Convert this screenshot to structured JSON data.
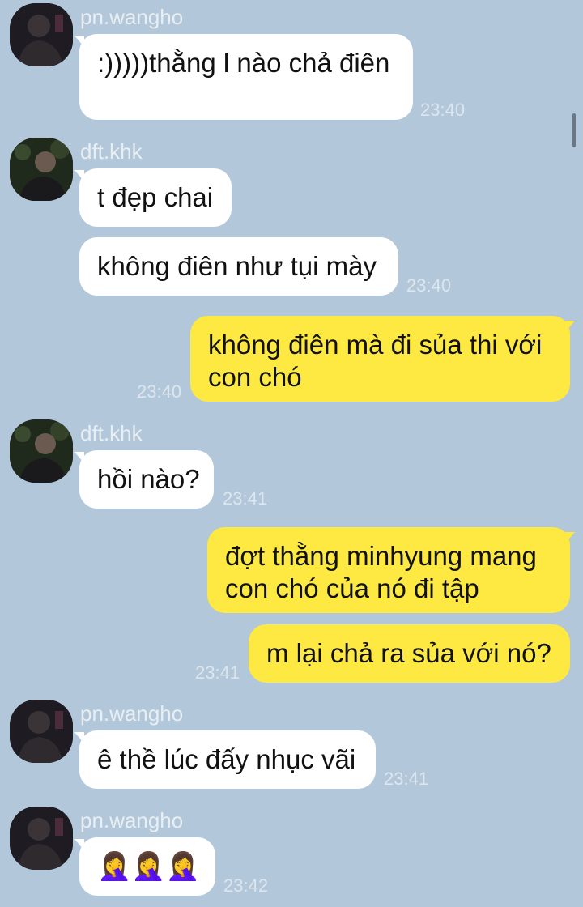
{
  "colors": {
    "background": "#b2c7d9",
    "incoming": "#ffffff",
    "outgoing": "#fde941",
    "timestamp": "#dde6ee"
  },
  "messages": [
    {
      "sender": "pn.wangho",
      "text": ":)))))thằng l nào chả điên",
      "time": "23:40"
    },
    {
      "sender": "dft.khk",
      "text": "t đẹp chai"
    },
    {
      "text": "không điên như tụi mày",
      "time": "23:40"
    },
    {
      "text": "không điên mà đi sủa thi với con chó",
      "time": "23:40"
    },
    {
      "sender": "dft.khk",
      "text": "hồi nào?",
      "time": "23:41"
    },
    {
      "text": "đợt thằng minhyung mang con chó của nó đi tập"
    },
    {
      "text": "m lại chả ra sủa với nó?",
      "time": "23:41"
    },
    {
      "sender": "pn.wangho",
      "text": "ê thề lúc đấy nhục vãi",
      "time": "23:41"
    },
    {
      "sender": "pn.wangho",
      "text": "🤦‍♀️🤦‍♀️🤦‍♀️",
      "time": "23:42"
    }
  ]
}
